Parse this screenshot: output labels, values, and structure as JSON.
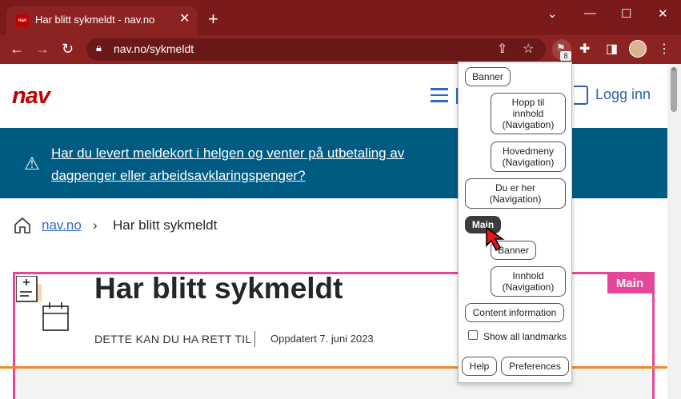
{
  "browser": {
    "tab_title": "Har blitt sykmeldt - nav.no",
    "tab_favicon": "nav",
    "new_tab": "+",
    "url": "nav.no/sykmeldt",
    "extension_badge": "8",
    "window_controls": [
      "minimize",
      "maximize",
      "close"
    ]
  },
  "site": {
    "logo": "nav",
    "login_label": "Logg inn",
    "banner_text": "Har du levert meldekort i helgen og venter på utbetaling av dagpenger eller arbeidsavklaringspenger?",
    "breadcrumb": {
      "home_link": "nav.no",
      "separator": "›",
      "current": "Har blitt sykmeldt"
    },
    "page_title": "Har blitt sykmeldt",
    "meta_category": "DETTE KAN DU HA RETT TIL",
    "meta_updated": "Oppdatert 7. juni 2023",
    "main_region_label": "Main"
  },
  "landmarks_popup": {
    "items": [
      {
        "label": "Banner"
      },
      {
        "label": "Hopp til innhold (Navigation)"
      },
      {
        "label": "Hovedmeny (Navigation)"
      },
      {
        "label": "Du er her (Navigation)"
      },
      {
        "label": "Main"
      },
      {
        "label": "Banner"
      },
      {
        "label": "Innhold (Navigation)"
      },
      {
        "label": "Content information"
      }
    ],
    "show_all_label": "Show all landmarks",
    "help_label": "Help",
    "preferences_label": "Preferences"
  },
  "colors": {
    "chrome_frame": "#7a1a1a",
    "nav_red": "#c30000",
    "banner_blue": "#005b82",
    "landmark_pink": "#e6469a",
    "link_blue": "#3366cc"
  }
}
